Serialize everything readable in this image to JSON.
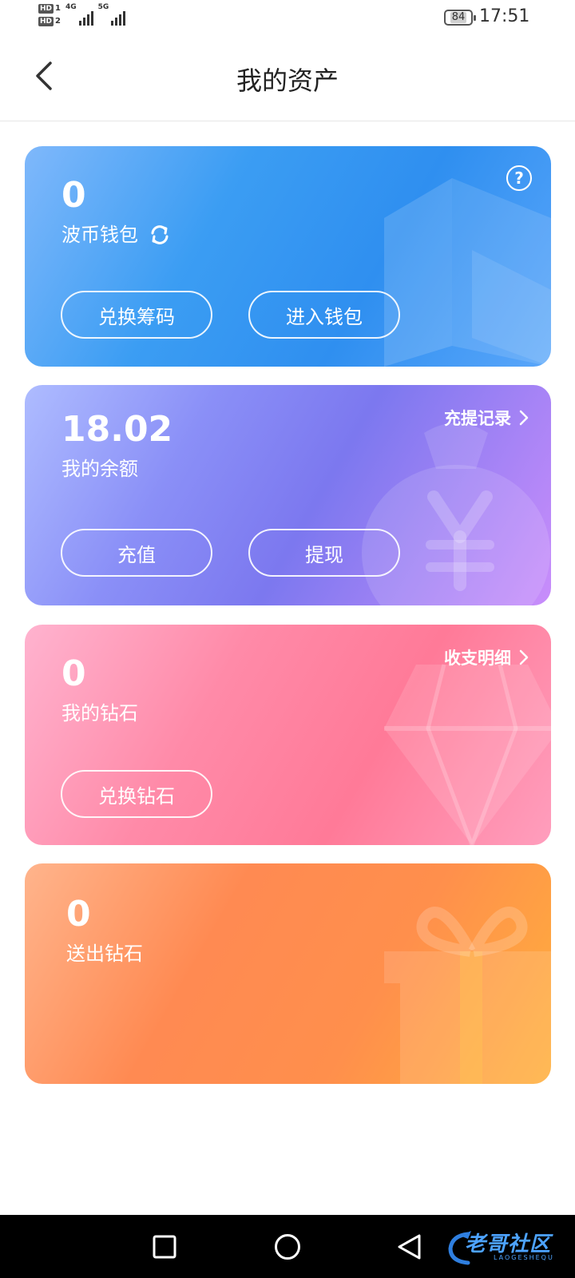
{
  "status_bar": {
    "sim1": "HD",
    "sim1_num": "1",
    "sim2": "HD",
    "sim2_num": "2",
    "net1": "4G",
    "net2": "5G",
    "battery": "84",
    "time": "17:51"
  },
  "header": {
    "title": "我的资产",
    "back_icon": "chevron-left-icon"
  },
  "wallet_card": {
    "amount": "0",
    "label": "波币钱包",
    "help_symbol": "?",
    "exchange_button": "兑换筹码",
    "enter_button": "进入钱包",
    "colors": {
      "start": "#7fb8fb",
      "end": "#2f8ff0"
    }
  },
  "balance_card": {
    "amount": "18.02",
    "label": "我的余额",
    "records_link": "充提记录",
    "recharge_button": "充值",
    "withdraw_button": "提现",
    "colors": {
      "start": "#aebcff",
      "end": "#c98dfb"
    }
  },
  "diamond_card": {
    "amount": "0",
    "label": "我的钻石",
    "details_link": "收支明细",
    "exchange_button": "兑换钻石",
    "colors": {
      "start": "#ffb3cf",
      "end": "#ff7a98"
    }
  },
  "sent_card": {
    "amount": "0",
    "label": "送出钻石",
    "colors": {
      "start": "#ffb48c",
      "end": "#ffb03c"
    }
  },
  "navbar": {
    "icons": [
      "recent-apps-icon",
      "home-icon",
      "back-icon"
    ],
    "watermark": "老哥社区",
    "watermark_sub": "LAOGESHEQU"
  }
}
